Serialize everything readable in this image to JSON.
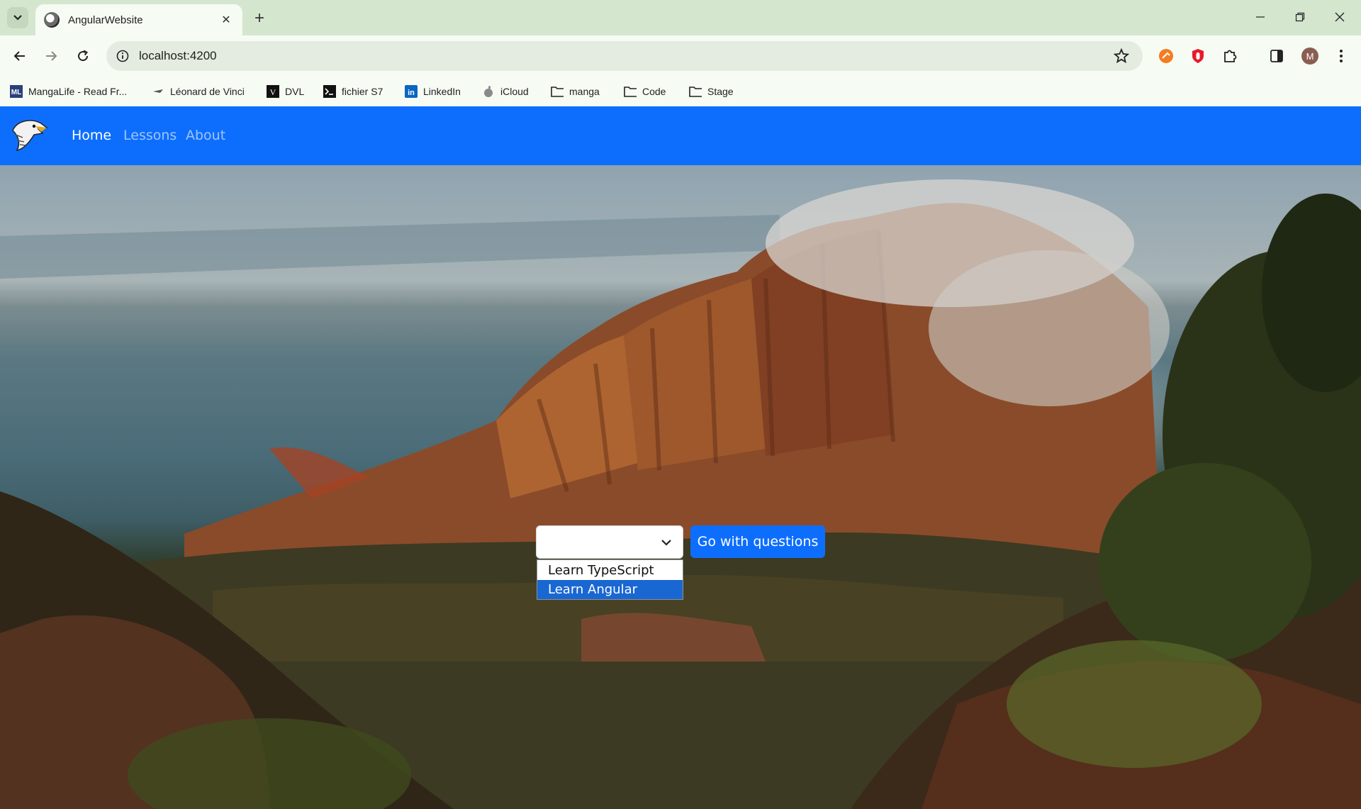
{
  "browser": {
    "tab_title": "AngularWebsite",
    "url": "localhost:4200",
    "profile_initial": "M",
    "bookmarks": [
      {
        "label": "MangaLife - Read Fr...",
        "icon": "mangalife-icon"
      },
      {
        "label": "Léonard de Vinci",
        "icon": "devinci-icon"
      },
      {
        "label": "DVL",
        "icon": "dvl-icon"
      },
      {
        "label": "fichier S7",
        "icon": "terminal-icon"
      },
      {
        "label": "LinkedIn",
        "icon": "linkedin-icon"
      },
      {
        "label": "iCloud",
        "icon": "apple-icon"
      },
      {
        "label": "manga",
        "icon": "folder-icon"
      },
      {
        "label": "Code",
        "icon": "folder-icon"
      },
      {
        "label": "Stage",
        "icon": "folder-icon"
      }
    ],
    "colors": {
      "frame": "#d5e6cf",
      "toolbar": "#f6fbf3"
    }
  },
  "app": {
    "brand_icon": "eagle-logo",
    "nav": [
      {
        "label": "Home",
        "active": true
      },
      {
        "label": "Lessons",
        "active": false
      },
      {
        "label": "About",
        "active": false
      }
    ],
    "select": {
      "value": "",
      "options": [
        "Learn TypeScript",
        "Learn Angular"
      ],
      "highlighted": "Learn Angular"
    },
    "go_button": "Go with questions",
    "colors": {
      "primary": "#0d6efd",
      "option_highlight": "#1967d2"
    }
  }
}
